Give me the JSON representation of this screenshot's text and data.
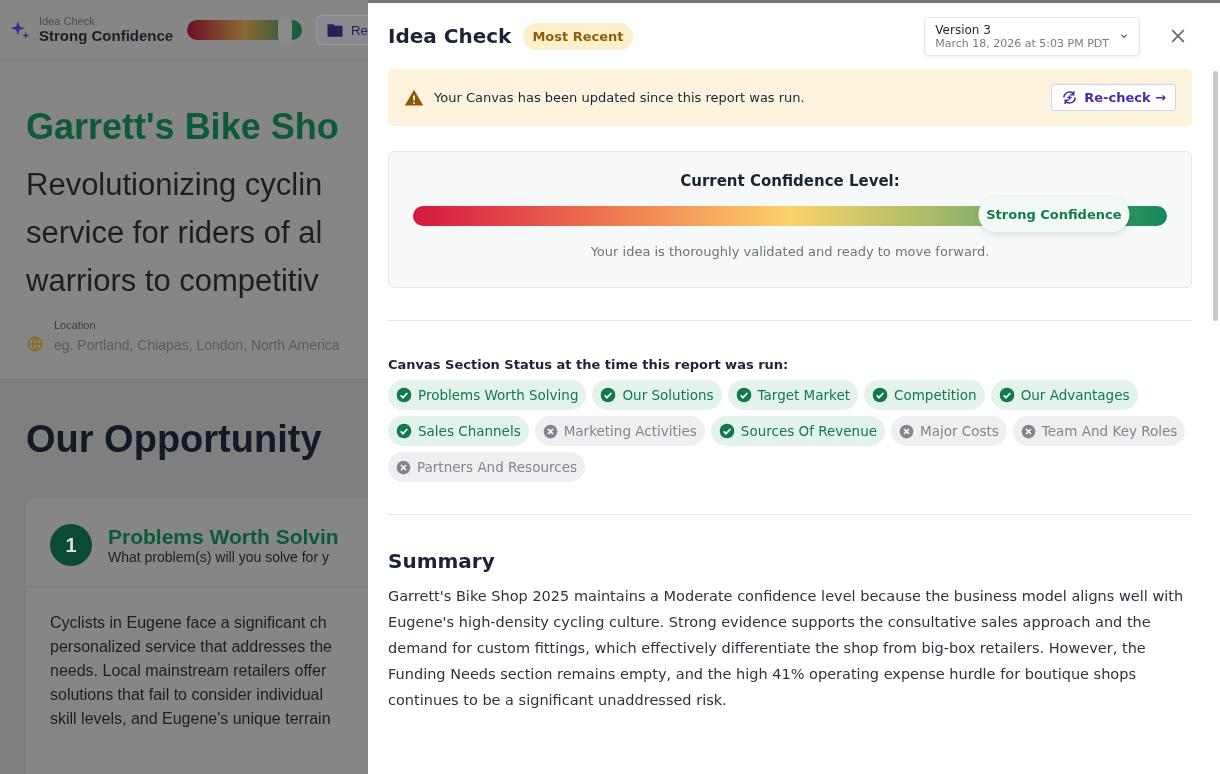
{
  "background_page": {
    "top_bar": {
      "label": "Idea Check",
      "status": "Strong Confidence",
      "level": 0.85,
      "button_label": "Re"
    },
    "title": "Garrett's Bike Sho",
    "subtitle_lines": [
      "Revolutionizing cyclin",
      "service for riders of al",
      "warriors to competitiv"
    ],
    "location": {
      "label": "Location",
      "placeholder": "eg. Portland, Chiapas, London, North America"
    },
    "section_title": "Our Opportunity",
    "card": {
      "number": "1",
      "title": "Problems Worth Solvin",
      "subtitle": "What problem(s) will you solve for y",
      "lines": [
        "Cyclists in Eugene face a significant ch",
        "personalized service that addresses the",
        "needs. Local mainstream retailers offer",
        "solutions that fail to consider individual",
        "skill levels, and Eugene's unique terrain"
      ]
    }
  },
  "drawer": {
    "title": "Idea Check",
    "badge": "Most Recent",
    "version": {
      "name": "Version 3",
      "date": "March 18, 2026 at 5:03 PM PDT"
    },
    "alert": {
      "text": "Your Canvas has been updated since this report was run.",
      "button": "Re-check →"
    },
    "confidence": {
      "title": "Current Confidence Level:",
      "level": 0.85,
      "label": "Strong Confidence",
      "caption": "Your idea is thoroughly validated and ready to move forward."
    },
    "status_heading": "Canvas Section Status at the time this report was run:",
    "sections": [
      {
        "label": "Problems Worth Solving",
        "checked": true
      },
      {
        "label": "Our Solutions",
        "checked": true
      },
      {
        "label": "Target Market",
        "checked": true
      },
      {
        "label": "Competition",
        "checked": true
      },
      {
        "label": "Our Advantages",
        "checked": true
      },
      {
        "label": "Sales Channels",
        "checked": true
      },
      {
        "label": "Marketing Activities",
        "checked": false
      },
      {
        "label": "Sources Of Revenue",
        "checked": true
      },
      {
        "label": "Major Costs",
        "checked": false
      },
      {
        "label": "Team And Key Roles",
        "checked": false
      },
      {
        "label": "Partners And Resources",
        "checked": false
      }
    ],
    "summary": {
      "title": "Summary",
      "text": "Garrett's Bike Shop 2025 maintains a Moderate confidence level because the business model aligns well with Eugene's high-density cycling culture. Strong evidence supports the consultative sales approach and the demand for custom fittings, which effectively differentiate the shop from big-box retailers. However, the Funding Needs section remains empty, and the high 41% operating expense hurdle for boutique shops continues to be a significant unaddressed risk."
    }
  }
}
